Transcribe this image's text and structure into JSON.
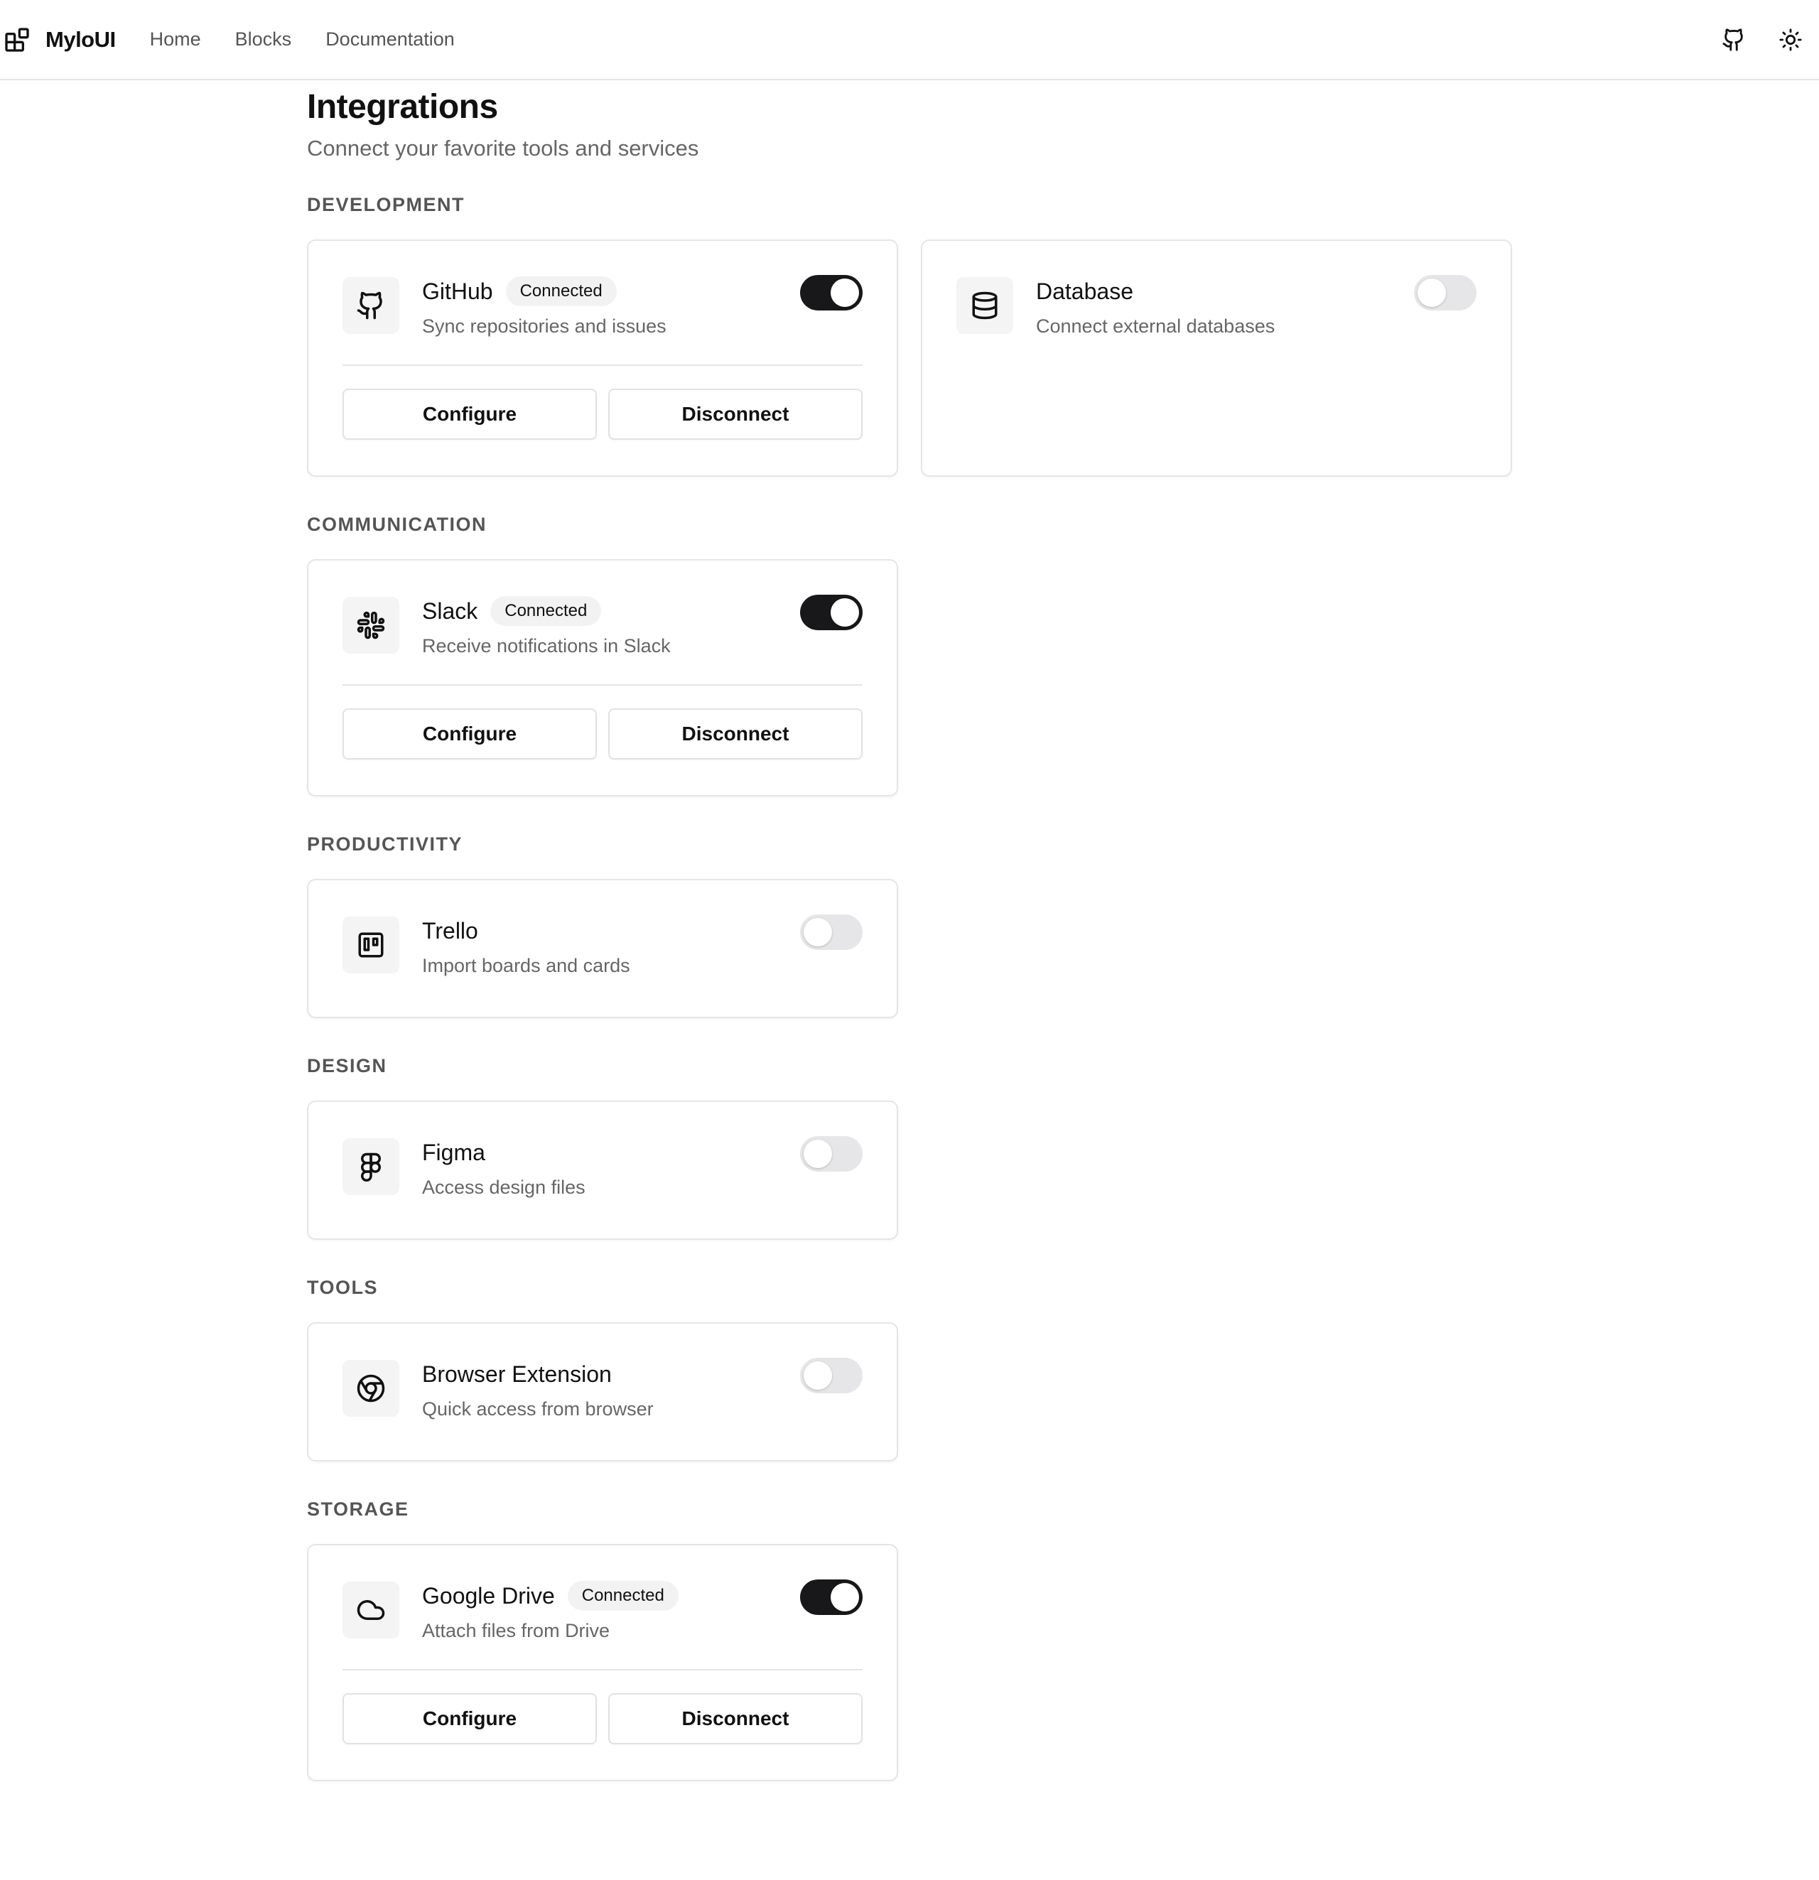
{
  "nav": {
    "brand": "MyloUI",
    "links": [
      "Home",
      "Blocks",
      "Documentation"
    ]
  },
  "page": {
    "title": "Integrations",
    "subtitle": "Connect your favorite tools and services"
  },
  "labels": {
    "configure": "Configure",
    "disconnect": "Disconnect",
    "connected": "Connected"
  },
  "sections": [
    {
      "label": "DEVELOPMENT",
      "items": [
        {
          "name": "GitHub",
          "description": "Sync repositories and issues",
          "icon": "github-icon",
          "connected": true
        },
        {
          "name": "Database",
          "description": "Connect external databases",
          "icon": "database-icon",
          "connected": false
        }
      ]
    },
    {
      "label": "COMMUNICATION",
      "items": [
        {
          "name": "Slack",
          "description": "Receive notifications in Slack",
          "icon": "slack-icon",
          "connected": true
        }
      ]
    },
    {
      "label": "PRODUCTIVITY",
      "items": [
        {
          "name": "Trello",
          "description": "Import boards and cards",
          "icon": "trello-icon",
          "connected": false
        }
      ]
    },
    {
      "label": "DESIGN",
      "items": [
        {
          "name": "Figma",
          "description": "Access design files",
          "icon": "figma-icon",
          "connected": false
        }
      ]
    },
    {
      "label": "TOOLS",
      "items": [
        {
          "name": "Browser Extension",
          "description": "Quick access from browser",
          "icon": "chrome-icon",
          "connected": false
        }
      ]
    },
    {
      "label": "STORAGE",
      "items": [
        {
          "name": "Google Drive",
          "description": "Attach files from Drive",
          "icon": "cloud-icon",
          "connected": true
        }
      ]
    }
  ],
  "colors": {
    "toggle_on": "#18181b",
    "toggle_off": "#e6e6e8",
    "border": "#e5e5e5",
    "muted_text": "#666666"
  }
}
